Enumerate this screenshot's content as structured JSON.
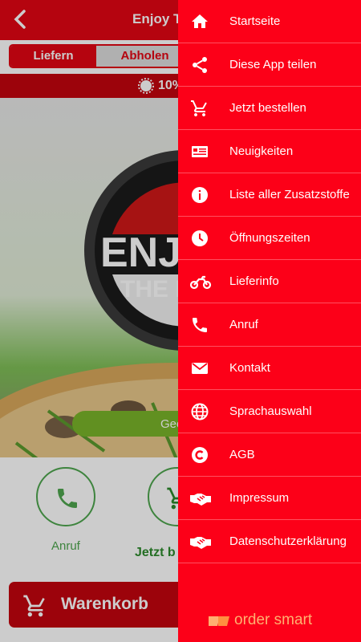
{
  "header": {
    "title": "Enjoy T"
  },
  "order_toggle": {
    "deliver": "Liefern",
    "pickup": "Abholen"
  },
  "promo": {
    "text": "10%"
  },
  "hero": {
    "logo_text_1": "ENJ",
    "logo_text_2": "THE P",
    "green_button": "Geö"
  },
  "actions": {
    "call_label": "Anruf",
    "order_label": "Jetzt b"
  },
  "cart": {
    "label": "Warenkorb"
  },
  "drawer": {
    "items": [
      {
        "label": "Startseite",
        "icon": "home-icon"
      },
      {
        "label": "Diese App teilen",
        "icon": "share-icon"
      },
      {
        "label": "Jetzt bestellen",
        "icon": "cart-icon"
      },
      {
        "label": "Neuigkeiten",
        "icon": "news-icon"
      },
      {
        "label": "Liste aller Zusatzstoffe",
        "icon": "info-icon"
      },
      {
        "label": "Öffnungszeiten",
        "icon": "clock-icon"
      },
      {
        "label": "Lieferinfo",
        "icon": "motorbike-icon"
      },
      {
        "label": "Anruf",
        "icon": "phone-icon"
      },
      {
        "label": "Kontakt",
        "icon": "mail-icon"
      },
      {
        "label": "Sprachauswahl",
        "icon": "globe-icon"
      },
      {
        "label": "AGB",
        "icon": "copyright-icon"
      },
      {
        "label": "Impressum",
        "icon": "handshake-icon"
      },
      {
        "label": "Datenschutzerklärung",
        "icon": "handshake-icon"
      }
    ],
    "brand": "order smart"
  },
  "colors": {
    "primary": "#e30613",
    "drawer": "#fc0018",
    "green": "#4ea64e"
  }
}
